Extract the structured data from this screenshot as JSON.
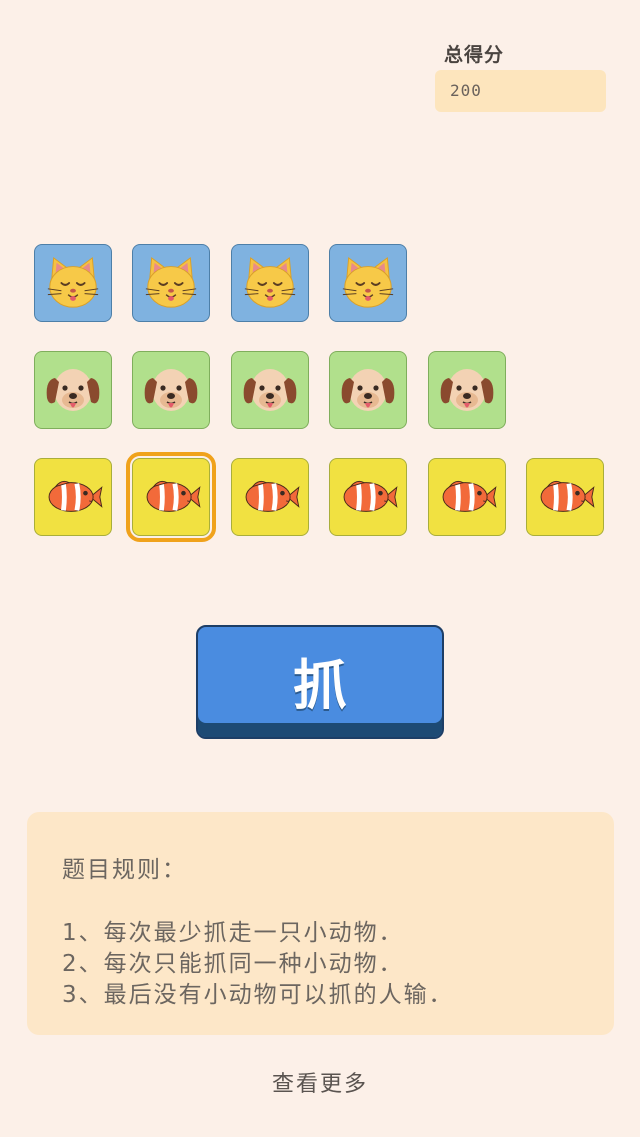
{
  "score": {
    "label": "总得分",
    "value": "200"
  },
  "board": {
    "rows": [
      {
        "animal": "cat",
        "count": 4
      },
      {
        "animal": "dog",
        "count": 5
      },
      {
        "animal": "fish",
        "count": 6,
        "selected_index": 1
      }
    ]
  },
  "grab_button": {
    "label": "抓"
  },
  "rules": {
    "title": "题目规则：",
    "items": [
      "1、每次最少抓走一只小动物．",
      "2、每次只能抓同一种小动物．",
      "3、最后没有小动物可以抓的人输．"
    ]
  },
  "more_link": "查看更多",
  "colors": {
    "background": "#fcf0e8",
    "cat_tile": "#7fb2e0",
    "dog_tile": "#b1e08c",
    "fish_tile": "#f1e141",
    "selection": "#f0a21b",
    "button": "#4a8ce0"
  }
}
